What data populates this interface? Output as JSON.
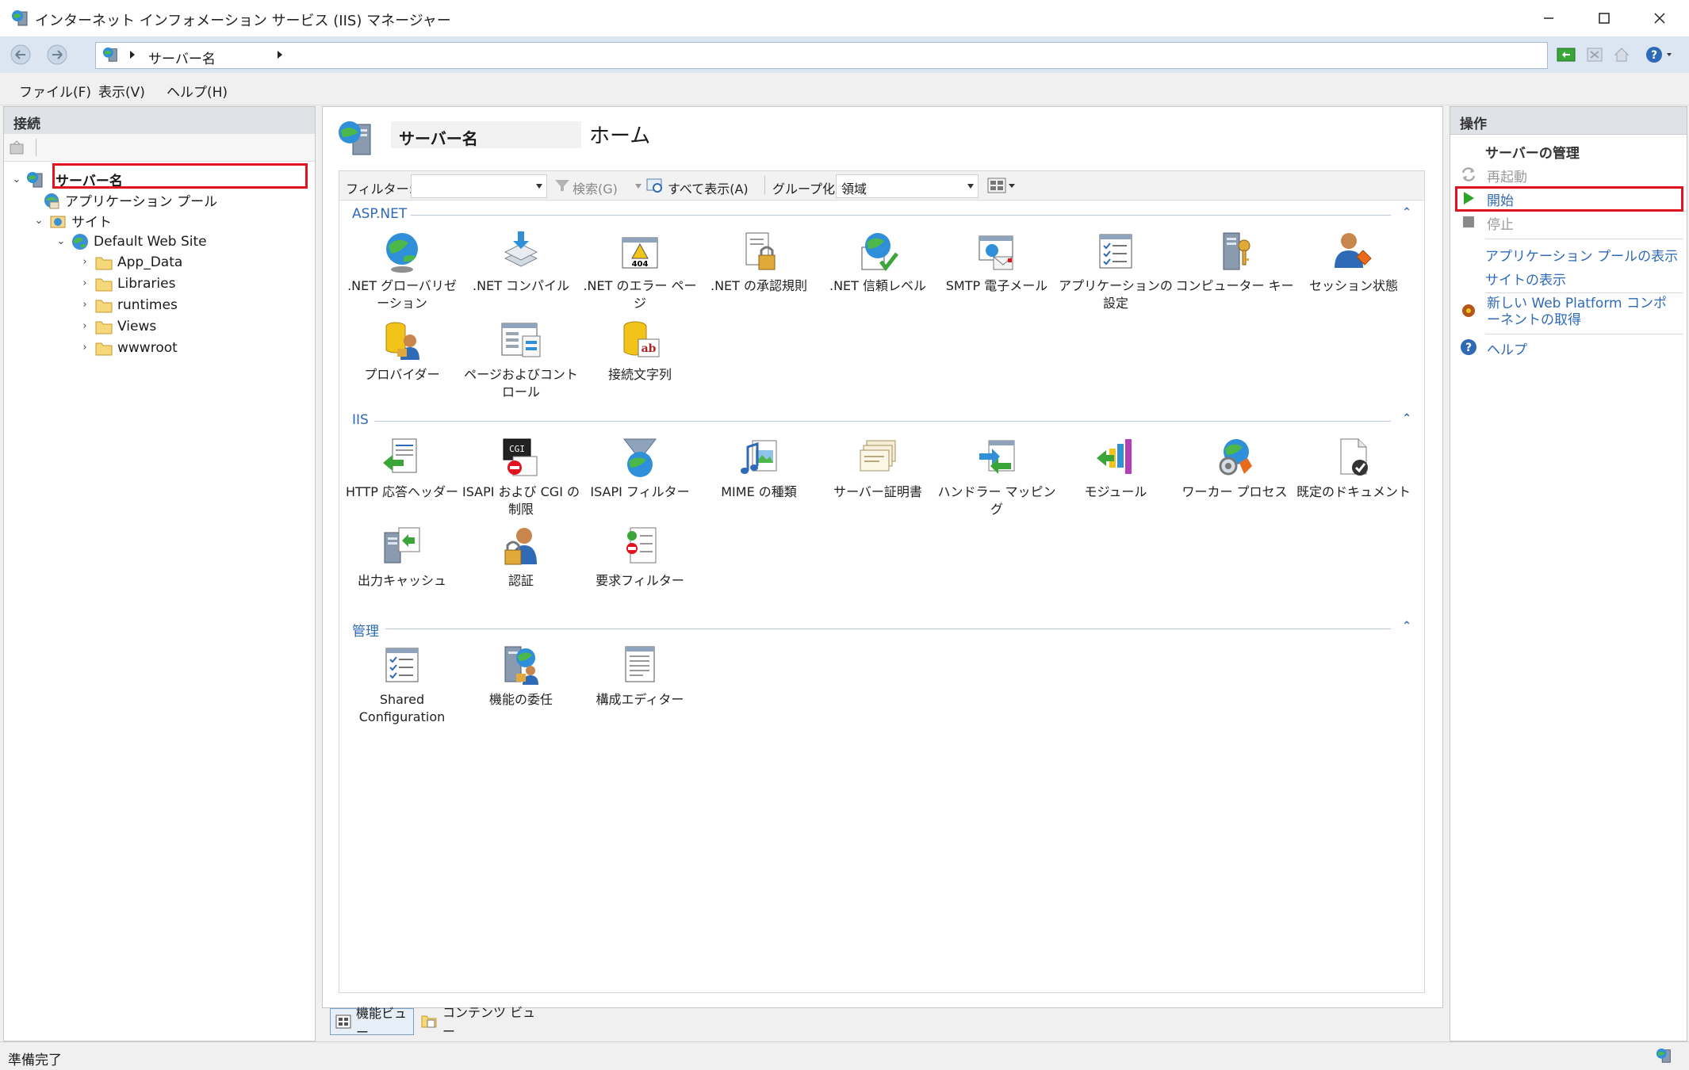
{
  "window": {
    "title": "インターネット インフォメーション サービス (IIS) マネージャー"
  },
  "address": {
    "crumb": "サーバー名"
  },
  "menu": [
    {
      "label": "ファイル(F)"
    },
    {
      "label": "表示(V)"
    },
    {
      "label": "ヘルプ(H)"
    }
  ],
  "connections": {
    "header": "接続",
    "tree": [
      {
        "label": "サーバー名",
        "level": 0,
        "expanded": true,
        "icon": "server-icon"
      },
      {
        "label": "アプリケーション プール",
        "level": 1,
        "icon": "app-pool-icon"
      },
      {
        "label": "サイト",
        "level": 1,
        "expanded": true,
        "icon": "sites-icon"
      },
      {
        "label": "Default Web Site",
        "level": 2,
        "expanded": true,
        "icon": "globe-icon"
      },
      {
        "label": "App_Data",
        "level": 3,
        "icon": "folder-icon"
      },
      {
        "label": "Libraries",
        "level": 3,
        "icon": "folder-icon"
      },
      {
        "label": "runtimes",
        "level": 3,
        "icon": "folder-icon"
      },
      {
        "label": "Views",
        "level": 3,
        "icon": "folder-icon"
      },
      {
        "label": "wwwroot",
        "level": 3,
        "icon": "folder-icon"
      }
    ]
  },
  "center": {
    "server_name": "サーバー名",
    "home_label": "ホーム",
    "filter": {
      "label": "フィルター:",
      "search": "検索(G)",
      "show_all": "すべて表示(A)",
      "group_by_label": "グループ化:",
      "group_by_value": "領域"
    },
    "groups": [
      {
        "name": "ASP.NET",
        "features": [
          {
            "label": ".NET グローバリゼーション",
            "icon": "globe-icon"
          },
          {
            "label": ".NET コンパイル",
            "icon": "compile-icon"
          },
          {
            "label": ".NET のエラー ページ",
            "icon": "error-page-icon"
          },
          {
            "label": ".NET の承認規則",
            "icon": "authorization-icon"
          },
          {
            "label": ".NET 信頼レベル",
            "icon": "trust-level-icon"
          },
          {
            "label": "SMTP 電子メール",
            "icon": "smtp-icon"
          },
          {
            "label": "アプリケーションの設定",
            "icon": "app-settings-icon"
          },
          {
            "label": "コンピューター キー",
            "icon": "machine-key-icon"
          },
          {
            "label": "セッション状態",
            "icon": "session-state-icon"
          },
          {
            "label": "プロバイダー",
            "icon": "providers-icon"
          },
          {
            "label": "ページおよびコントロール",
            "icon": "pages-controls-icon"
          },
          {
            "label": "接続文字列",
            "icon": "connection-strings-icon"
          }
        ]
      },
      {
        "name": "IIS",
        "features": [
          {
            "label": "HTTP 応答ヘッダー",
            "icon": "http-headers-icon"
          },
          {
            "label": "ISAPI および CGI の制限",
            "icon": "cgi-restrictions-icon"
          },
          {
            "label": "ISAPI フィルター",
            "icon": "isapi-filter-icon"
          },
          {
            "label": "MIME の種類",
            "icon": "mime-types-icon"
          },
          {
            "label": "サーバー証明書",
            "icon": "certificates-icon"
          },
          {
            "label": "ハンドラー マッピング",
            "icon": "handler-mappings-icon"
          },
          {
            "label": "モジュール",
            "icon": "modules-icon"
          },
          {
            "label": "ワーカー プロセス",
            "icon": "worker-process-icon"
          },
          {
            "label": "既定のドキュメント",
            "icon": "default-document-icon"
          },
          {
            "label": "出力キャッシュ",
            "icon": "output-cache-icon"
          },
          {
            "label": "認証",
            "icon": "authentication-icon"
          },
          {
            "label": "要求フィルター",
            "icon": "request-filtering-icon"
          }
        ]
      },
      {
        "name": "管理",
        "features": [
          {
            "label": "Shared Configuration",
            "icon": "shared-config-icon"
          },
          {
            "label": "機能の委任",
            "icon": "feature-delegation-icon"
          },
          {
            "label": "構成エディター",
            "icon": "config-editor-icon"
          }
        ]
      }
    ]
  },
  "bottom_tabs": [
    {
      "label": "機能ビュー",
      "active": true
    },
    {
      "label": "コンテンツ ビュー",
      "active": false
    }
  ],
  "actions": {
    "header": "操作",
    "section_title": "サーバーの管理",
    "restart": "再起動",
    "start": "開始",
    "stop": "停止",
    "view_app_pools": "アプリケーション プールの表示",
    "view_sites": "サイトの表示",
    "get_components": "新しい Web Platform コンポーネントの取得",
    "help": "ヘルプ"
  },
  "status": {
    "text": "準備完了"
  },
  "colors": {
    "highlight": "#e0141e",
    "link": "#2f6ab6",
    "start_green": "#2aa52a"
  }
}
